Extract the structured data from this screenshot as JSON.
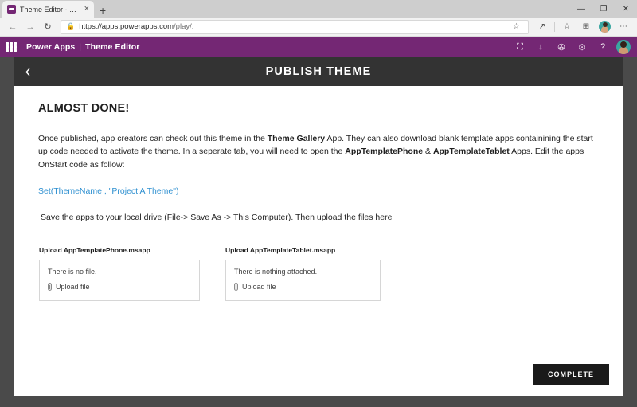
{
  "browser": {
    "tab": {
      "title": "Theme Editor - Power Apps",
      "favicon": "powerapps-favicon",
      "close_label": "×"
    },
    "new_tab_label": "+",
    "window_controls": {
      "minimize": "—",
      "maximize": "❐",
      "close": "✕"
    },
    "nav": {
      "back": "←",
      "forward": "→",
      "refresh": "↻"
    },
    "url": {
      "lock": "🔒",
      "prefix": "https://apps.powerapps.com",
      "suffix": "/play/."
    },
    "toolbar_icons": {
      "favorite": "☆",
      "collections_pen": "↗",
      "favorites_bar": "☆",
      "collections": "⊞",
      "profile": "avatar",
      "settings_more": "⋯"
    }
  },
  "app_bar": {
    "waffle": "app-launcher-icon",
    "brand": "Power Apps",
    "separator": "|",
    "app_name": "Theme Editor",
    "icons": {
      "fullscreen": "⛶",
      "download": "↓",
      "notifications": "✇",
      "settings": "⚙",
      "help": "?",
      "avatar": "user-avatar"
    }
  },
  "screen": {
    "back_icon": "‹",
    "title": "PUBLISH THEME",
    "headline": "ALMOST DONE!",
    "paragraph": {
      "part1": "Once published, app creators can check out this theme in the ",
      "bold1": "Theme Gallery",
      "part2": " App. They can also download blank template apps containining the start up code needed to activate the theme. In a seperate tab, you will need to open the ",
      "bold2": "AppTemplatePhone",
      "part3": " & ",
      "bold3": "AppTemplateTablet",
      "part4": " Apps. Edit the apps OnStart code as follow:"
    },
    "code_line": "Set(ThemeName , \"Project A Theme\")",
    "code_color": "#2d8fd0",
    "save_line": "Save the apps to your local drive (File-> Save As -> This Computer).  Then upload the files here",
    "uploads": [
      {
        "label": "Upload AppTemplatePhone.msapp",
        "empty_text": "There is no file.",
        "link_text": "Upload file",
        "icon": "paperclip-icon"
      },
      {
        "label": "Upload AppTemplateTablet.msapp",
        "empty_text": "There is nothing attached.",
        "link_text": "Upload file",
        "icon": "paperclip-icon"
      }
    ],
    "complete_button": "COMPLETE"
  },
  "colors": {
    "brand_purple": "#742774",
    "header_dark": "#333333",
    "frame_gray": "#4a4a4a",
    "button_black": "#1a1a1a",
    "code_blue": "#2d8fd0"
  }
}
